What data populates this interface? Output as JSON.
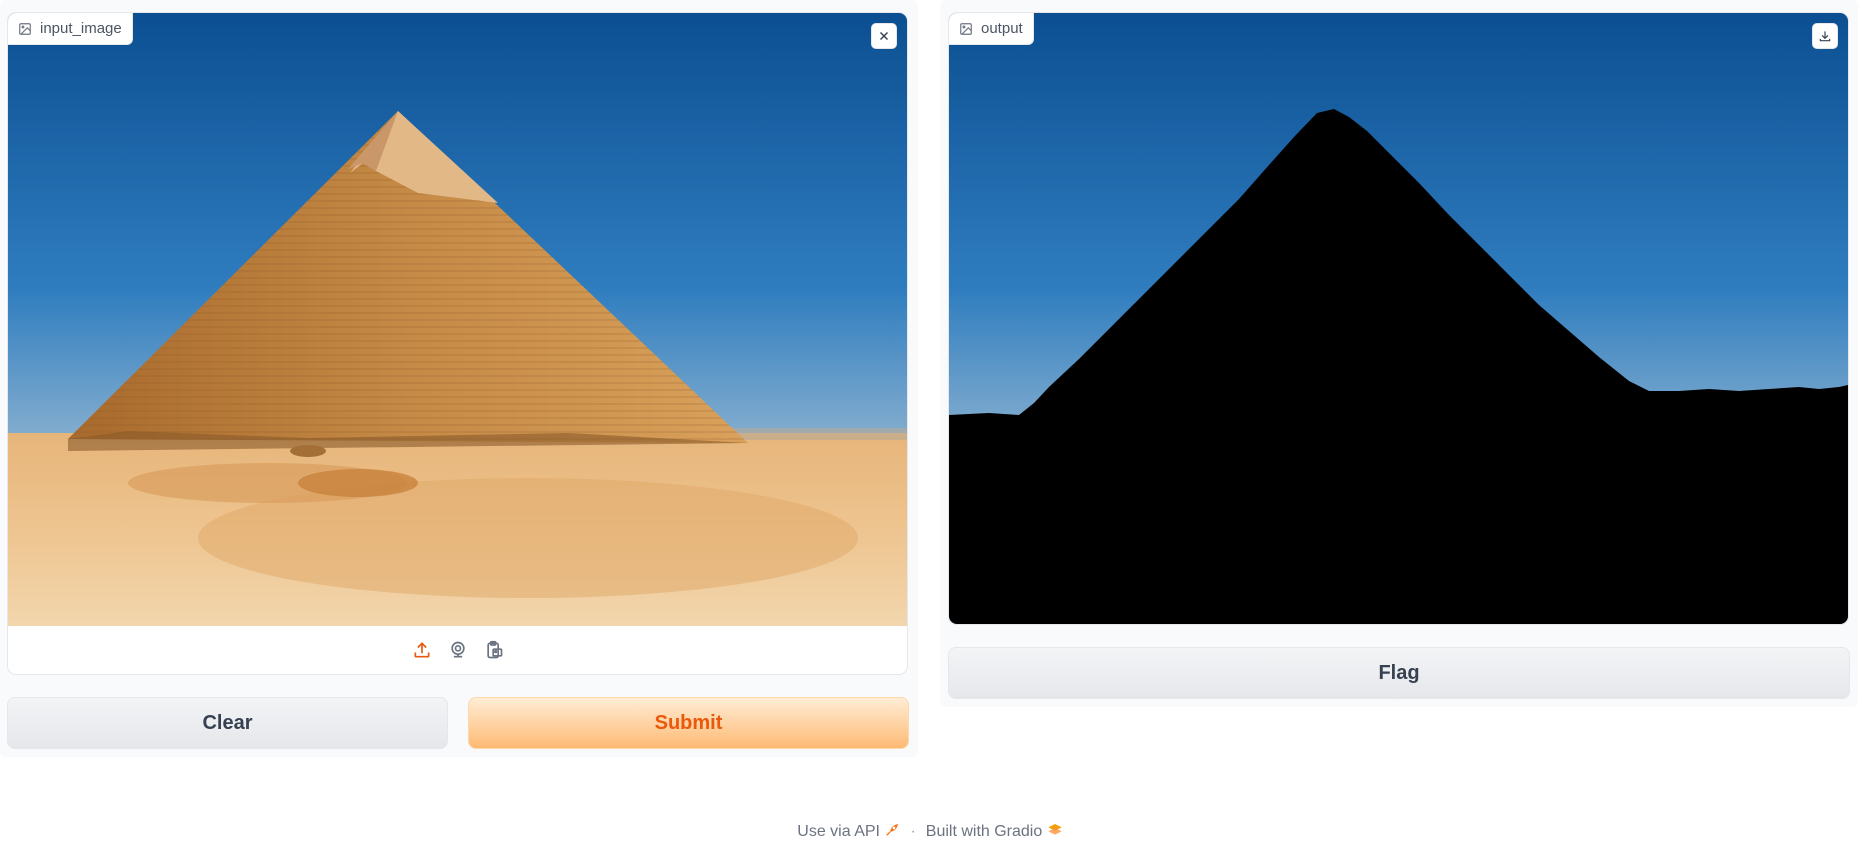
{
  "input": {
    "label": "input_image",
    "clear_icon": "close-icon",
    "sources": [
      "upload-icon",
      "webcam-icon",
      "clipboard-icon"
    ]
  },
  "output": {
    "label": "output",
    "download_icon": "download-icon"
  },
  "buttons": {
    "clear_label": "Clear",
    "submit_label": "Submit",
    "flag_label": "Flag"
  },
  "footer": {
    "api_text": "Use via API",
    "separator": "·",
    "built_text": "Built with Gradio"
  },
  "colors": {
    "accent": "#ea580c",
    "primary_bg": "#fdba74"
  }
}
